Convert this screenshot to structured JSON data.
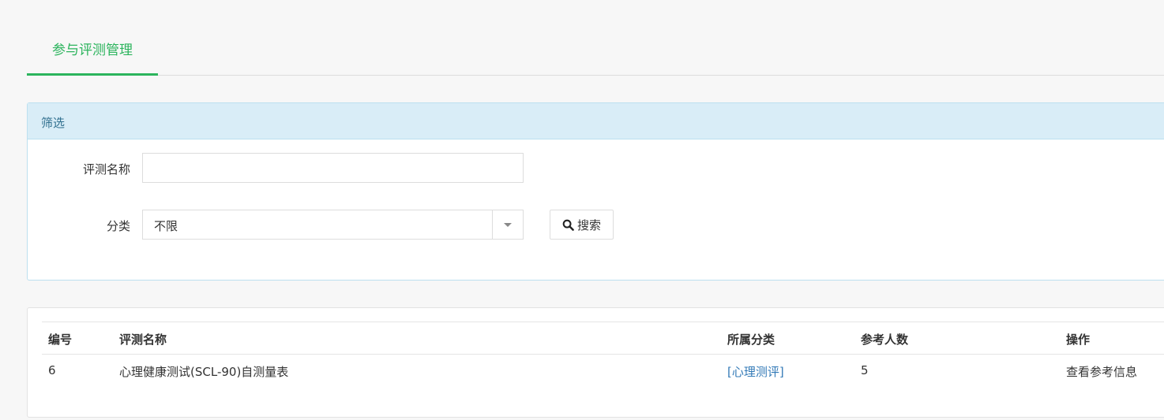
{
  "tabs": [
    {
      "label": "参与评测管理",
      "active": true
    }
  ],
  "filter": {
    "title": "筛选",
    "name_label": "评测名称",
    "name_value": "",
    "category_label": "分类",
    "category_value": "不限",
    "search_label": "搜索"
  },
  "table": {
    "headers": [
      "编号",
      "评测名称",
      "所属分类",
      "参考人数",
      "操作"
    ],
    "rows": [
      {
        "id": "6",
        "name": "心理健康测试(SCL-90)自测量表",
        "category": "[心理测评]",
        "count": "5",
        "action": "查看参考信息"
      }
    ]
  },
  "colors": {
    "accent": "#2cb45d",
    "panel_head_bg": "#d9edf7",
    "link": "#337ab7"
  }
}
